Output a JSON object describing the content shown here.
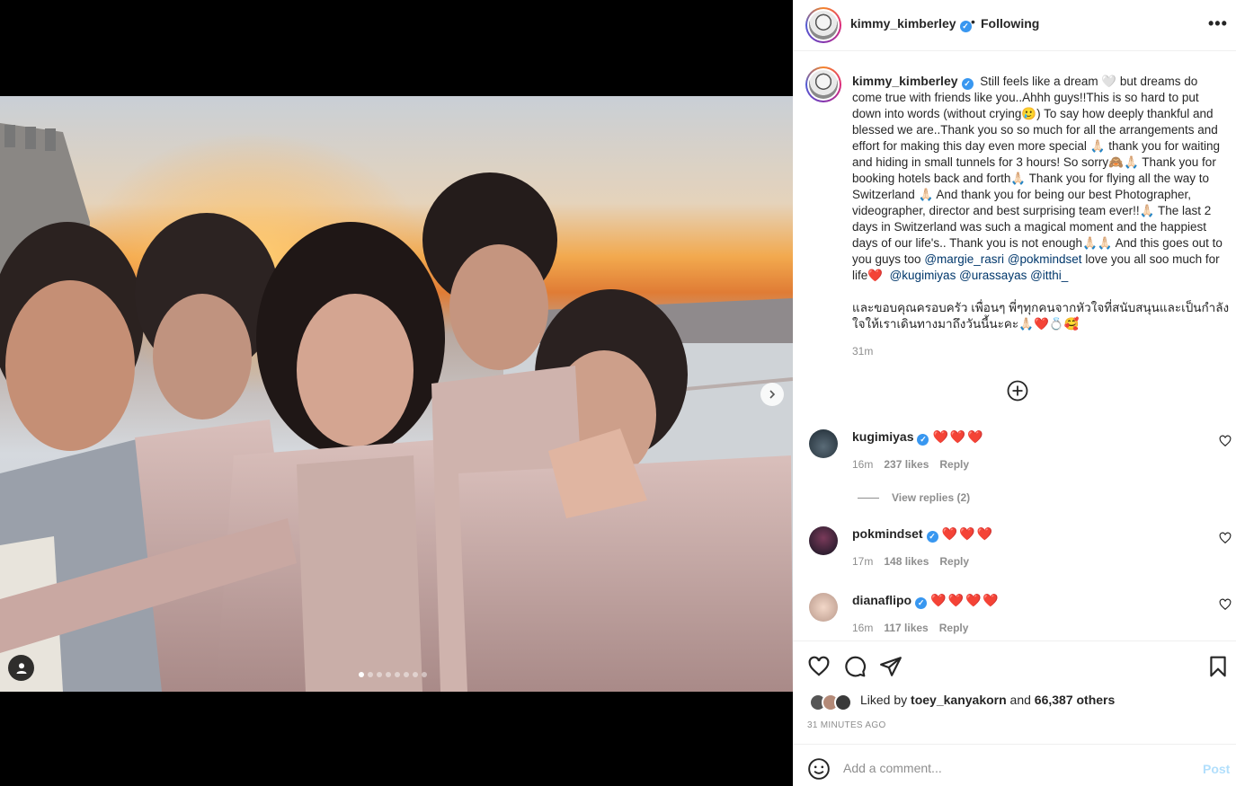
{
  "post": {
    "username": "kimmy_kimberley",
    "follow_separator": "•",
    "follow_label": "Following",
    "more_label": "•••"
  },
  "caption": {
    "username": "kimmy_kimberley",
    "text_1": "Still feels like a dream 🤍 but dreams do come true with friends like you..Ahhh guys!!This is so hard to put down into words (without crying🥲) To say how deeply thankful and blessed we are..Thank you so so much for all the arrangements and effort for making this day even more special 🙏🏻 thank you for waiting and hiding in small tunnels for 3 hours! So sorry🙈🙏🏻 Thank you for booking hotels back and forth🙏🏻 Thank you for flying all the way to Switzerland 🙏🏻 And thank you for being our best Photographer, videographer, director and best surprising team ever!!🙏🏻 The last 2 days in Switzerland was such a magical moment and the happiest days of our life's.. Thank you is not enough🙏🏻🙏🏻 And this goes out to you guys too ",
    "mention_1": "@margie_rasri",
    "mention_2": "@pokmindset",
    "text_2": " love you all soo much for life❤️ ",
    "mention_3": "@kugimiyas",
    "mention_4": "@urassayas",
    "mention_5": "@itthi_",
    "thai_text": "และขอบคุณครอบครัว เพื่อนๆ พี่ๆทุกคนจากหัวใจที่สนับสนุนและเป็นกำลังใจให้เราเดินทางมาถึงวันนี้นะคะ🙏🏻❤️💍🥰",
    "time": "31m"
  },
  "comments": [
    {
      "username": "kugimiyas",
      "text": "❤️❤️❤️",
      "time": "16m",
      "likes": "237 likes",
      "reply": "Reply"
    },
    {
      "username": "pokmindset",
      "text": "❤️❤️❤️",
      "time": "17m",
      "likes": "148 likes",
      "reply": "Reply"
    },
    {
      "username": "dianaflipo",
      "text": "❤️❤️❤️❤️",
      "time": "16m",
      "likes": "117 likes",
      "reply": "Reply"
    }
  ],
  "view_replies": "View replies (2)",
  "likes": {
    "prefix": "Liked by ",
    "user": "toey_kanyakorn",
    "middle": " and ",
    "others": "66,387 others"
  },
  "timestamp": "31 MINUTES AGO",
  "add_comment": {
    "placeholder": "Add a comment...",
    "post_label": "Post"
  },
  "carousel": {
    "total": 8,
    "active": 0
  },
  "colors": {
    "link": "#00376b",
    "verified": "#3897f0",
    "heart": "#ed1c35",
    "post_disabled": "#b2dffc"
  }
}
